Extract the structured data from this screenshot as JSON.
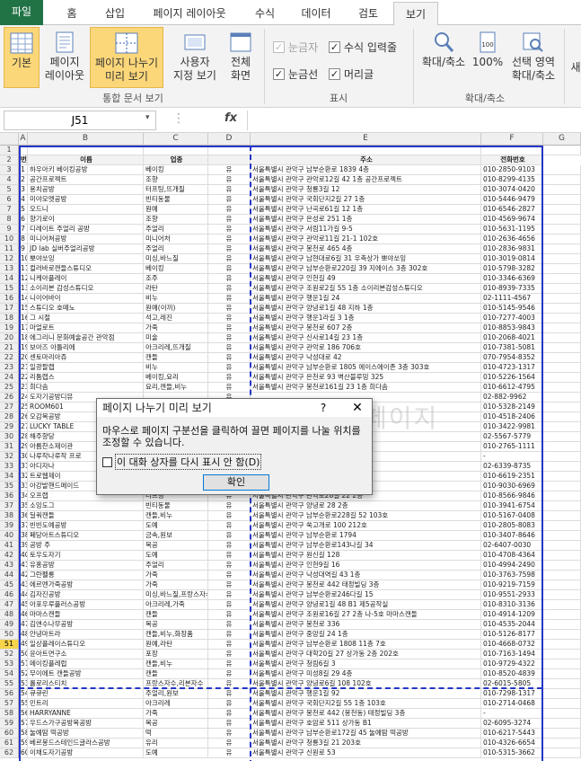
{
  "tabs": [
    "파일",
    "홈",
    "삽입",
    "페이지 레이아웃",
    "수식",
    "데이터",
    "검토",
    "보기"
  ],
  "ribbon": {
    "group1": {
      "buttons": [
        "기본",
        "페이지\n레이아웃",
        "페이지 나누기\n미리 보기",
        "사용자\n지정 보기",
        "전체\n화면"
      ],
      "label": "통합 문서 보기"
    },
    "group2": {
      "checks": [
        {
          "label": "눈금자",
          "checked": true,
          "disabled": true
        },
        {
          "label": "수식 입력줄",
          "checked": true,
          "disabled": false
        },
        {
          "label": "눈금선",
          "checked": true,
          "disabled": false
        },
        {
          "label": "머리글",
          "checked": true,
          "disabled": false
        }
      ],
      "label": "표시"
    },
    "group3": {
      "buttons": [
        "확대/축소",
        "100%",
        "선택 영역\n확대/축소"
      ],
      "label": "확대/축소"
    },
    "more_label": "새"
  },
  "formula_bar": {
    "namebox": "J51",
    "fx": "fx",
    "value": ""
  },
  "columns": [
    "A",
    "B",
    "C",
    "D",
    "E",
    "F",
    "G"
  ],
  "header_row": [
    "번호",
    "이름",
    "업종",
    "",
    "주소",
    "전화번호"
  ],
  "rows": [
    [
      "1",
      "하우아키 베이킹공방",
      "베이킹",
      "유",
      "서울특별시 관악구 남부순환로 1839 4층",
      "010-2850-9103"
    ],
    [
      "2",
      "공간프로젝트",
      "조향",
      "유",
      "서울특별시 관악구 관악로12길 42 1층 공간프로젝트",
      "010-8299-4135"
    ],
    [
      "3",
      "용치공방",
      "터프팅,뜨개질",
      "유",
      "서울특별시 관악구 청룡3길 12",
      "010-3074-0420"
    ],
    [
      "4",
      "미야모멧공방",
      "빈티동물",
      "유",
      "서울특별시 관악구 국회단지2길 27 1층",
      "010-5446-9479"
    ],
    [
      "5",
      "오드니",
      "원예",
      "유",
      "서울특별시 관악구 난곡로61길 12 1층",
      "010-6546-2827"
    ],
    [
      "6",
      "향기로이",
      "조향",
      "유",
      "서울특별시 관악구 은성로 251 1층",
      "010-4569-9674"
    ],
    [
      "7",
      "디레이트 주얼리 공방",
      "주얼리",
      "유",
      "서울특별시 관악구 서림11가길 9-5",
      "010-5631-1195"
    ],
    [
      "8",
      "미니어쳐공방",
      "미니어처",
      "유",
      "서울특별시 관악구 관악로11길 21-1 102호",
      "010-2636-4656"
    ],
    [
      "9",
      "JD lab 실버주얼리공방",
      "주얼리",
      "유",
      "서울특별시 관악구 봉천로 465 4층",
      "010-2836-9831"
    ],
    [
      "10",
      "뽀야쏘잉",
      "미싱,바느질",
      "유",
      "서울특별시 관악구 남현대로6길 31 우측상가 뽀야쏘잉",
      "010-3019-0814"
    ],
    [
      "11",
      "컬러바로캔들스튜디오",
      "베이킹",
      "유",
      "서울특별시 관악구 남부순환로220길 39 지에이스 3층 302호",
      "010-5798-3282"
    ],
    [
      "12",
      "니케아플레이",
      "조주",
      "유",
      "서울특별시 관악구 인헌길 49",
      "010-3346-6369"
    ],
    [
      "13",
      "소이리본 감성스튜디오",
      "라탄",
      "유",
      "서울특별시 관악구 조원로2길 55 1층 소이리본감성스튜디오",
      "010-8939-7335"
    ],
    [
      "14",
      "니이어바이",
      "비누",
      "유",
      "서울특별시 관악구 행운1길 24",
      "02-1111-4567"
    ],
    [
      "15",
      "스튜디오 호떼노",
      "원예(이끼)",
      "유",
      "서울특별시 관악구 양녕로1길 48 지하 1층",
      "010-5145-9546"
    ],
    [
      "16",
      "그 시절",
      "석고,레진",
      "유",
      "서울특별시 관악구 행운1라길 3 1층",
      "010-7277-4003"
    ],
    [
      "17",
      "마얼로트",
      "가죽",
      "유",
      "서울특별시 관악구 봉천로 607 2층",
      "010-8853-9843"
    ],
    [
      "18",
      "에그리니 문화예술공간 관악점",
      "미술",
      "유",
      "서울특별시 관악구 신사로14길 23 1층",
      "010-2068-4021"
    ],
    [
      "19",
      "보아즈 아틀리에",
      "아크리레,뜨개질",
      "유",
      "서울특별시 관악구 관악로 186 706호",
      "010-7381-5081"
    ],
    [
      "20",
      "센토마리아쥬",
      "캔들",
      "유",
      "서울특별시 관악구 낙성대로 42",
      "070-7954-8352"
    ],
    [
      "21",
      "일광팔랩",
      "비누",
      "유",
      "서울특별시 관악구 남부순환로 1805 에이스에이존 3층 303호",
      "010-4723-1317"
    ],
    [
      "22",
      "리툼랩스",
      "베이킹,요리",
      "유",
      "서울특별시 관악구 은천로 93 벽산블루밍 325",
      "010-5226-1564"
    ],
    [
      "23",
      "희다솜",
      "요리,캔들,비누",
      "유",
      "서울특별시 관악구 봉천로161길 23 1층 희다솜",
      "010-6612-4795"
    ],
    [
      "24",
      "도자기공방디뮤",
      "",
      "유",
      "",
      "02-882-9962"
    ],
    [
      "25",
      "ROOM601",
      "",
      "유",
      "",
      "010-5328-2149"
    ],
    [
      "26",
      "오감목공방",
      "",
      "유",
      "아파트 상가동 B1층",
      "010-4518-2406"
    ],
    [
      "27",
      "LUCKY TABLE",
      "",
      "유",
      "",
      "010-3422-9981"
    ],
    [
      "28",
      "해주향당",
      "",
      "유",
      "1층",
      "02-5567-5779"
    ],
    [
      "29",
      "아름찬소제이관",
      "",
      "유",
      "",
      "010-2765-1111"
    ],
    [
      "30",
      "나루작나루작 프로",
      "",
      "유",
      "",
      "-"
    ],
    [
      "31",
      "아디자나",
      "",
      "유",
      "SANAT",
      "02-6339-8735"
    ],
    [
      "32",
      "트로웹제이",
      "",
      "유",
      "제이",
      "010-6619-2351"
    ],
    [
      "33",
      "아강발핸드메이드",
      "",
      "유",
      "",
      "010-9030-6969"
    ],
    [
      "34",
      "오프랩",
      "터프팅",
      "유",
      "서울특별시 관악구 관악로28길 22 2층",
      "010-8566-9846"
    ],
    [
      "35",
      "소잉도그",
      "빈티동물",
      "유",
      "서울특별시 관악구 양녕로 28 2층",
      "010-3941-6754"
    ],
    [
      "36",
      "딜쿼캔들",
      "캔들,비누",
      "유",
      "서울특별시 관악구 남부순환로228길 52 103호",
      "010-5167-0408"
    ],
    [
      "37",
      "빈빈도예공방",
      "도예",
      "유",
      "서울특별시 관악구 쑥고개로 100 212호",
      "010-2805-8083"
    ],
    [
      "38",
      "폐당아트스튜디오",
      "금속,원보",
      "유",
      "서울특별시 관악구 남부순환로 1794",
      "010-3407-8646"
    ],
    [
      "39",
      "공방 주",
      "목공",
      "유",
      "서울특별시 관악구 남부순환로143나길 34",
      "02-6407-0030"
    ],
    [
      "40",
      "토우도자기",
      "도예",
      "유",
      "서울특별시 관악구 원신길 128",
      "010-4708-4364"
    ],
    [
      "41",
      "유홍공방",
      "주얼리",
      "유",
      "서울특별시 관악구 인헌9길 16",
      "010-4994-2490"
    ],
    [
      "42",
      "그란펠롱",
      "가죽",
      "유",
      "서울특별시 관악구 낙성대역길 43 1층",
      "010-3763-7598"
    ],
    [
      "43",
      "에르멘가죽공방",
      "가죽",
      "유",
      "서울특별시 관악구 봉천로 442 태정빌딩 3층",
      "010-9219-7159"
    ],
    [
      "44",
      "김자진공방",
      "미싱,바느질,프랑스자수",
      "유",
      "서울특별시 관악구 남부순환로246다길 15",
      "010-9551-2933"
    ],
    [
      "45",
      "아포우루플러스공방",
      "아크리레,가죽",
      "유",
      "서울특별시 관악구 양녕로1길 48 B1 제5공작실",
      "010-8310-3136"
    ],
    [
      "46",
      "마마스캔들",
      "캔들",
      "유",
      "서울특별시 관악구 조원로16길 27 2층 나-5호 마마스캔들",
      "010-4914-1209"
    ],
    [
      "47",
      "김앤수나무공방",
      "목공",
      "유",
      "서울특별시 관악구 봉천로 336",
      "010-4535-2044"
    ],
    [
      "48",
      "안녕마트라",
      "캔들,비누,화장품",
      "유",
      "서울특별시 관악구 중앙길 24 1층",
      "010-5126-8177"
    ],
    [
      "49",
      "일상플레이스튜디오",
      "원예,라탄",
      "유",
      "서울특별시 관악구 남부순환로 1808 11층 7호",
      "010-4668-0732"
    ],
    [
      "50",
      "윤아트면구소",
      "포장",
      "유",
      "서울특별시 관악구 대학20길 27 상가동 2층 202호",
      "010-7163-1494"
    ],
    [
      "51",
      "메이킹플레럽",
      "캔들,비누",
      "유",
      "서울특별시 관악구 청림6길 3",
      "010-9729-4322"
    ],
    [
      "52",
      "무이에트 캔들공방",
      "캔들",
      "유",
      "서울특별시 관악구 미성8길 29 4층",
      "010-8520-4839"
    ],
    [
      "53",
      "롤로리스티치",
      "프랑스자수,리본자수",
      "유",
      "서울특별시 관악구 양녕로6길 108 102호",
      "02-6015-5805"
    ],
    [
      "54",
      "큐큐린",
      "주얼리,원보",
      "유",
      "서울특별시 관악구 행운1길 92",
      "010-7298-1317"
    ],
    [
      "55",
      "민트리",
      "아크리레",
      "유",
      "서울특별시 관악구 국회단지2길 55 1층 103호",
      "010-2714-0468"
    ],
    [
      "56",
      "HARRYANNE",
      "가죽",
      "유",
      "서울특별시 관악구 봉천로 442 (봉천동) 태정빌딩 3층",
      "-"
    ],
    [
      "57",
      "우드스가구공방목공방",
      "목공",
      "유",
      "서울특별시 관악구 호암로 511 상가동 B1",
      "02-6095-3274"
    ],
    [
      "58",
      "눌예땀 떡공방",
      "떡",
      "유",
      "서울특별시 관악구 남부순환로172길 45 눌예땀 떡공방",
      "010-6217-5443"
    ],
    [
      "59",
      "베르봉드스테인드글라스공방",
      "유리",
      "유",
      "서울특별시 관악구 청룡3길 21 203호",
      "010-4326-6654"
    ],
    [
      "60",
      "이채도자기공방",
      "도예",
      "유",
      "서울특별시 관악구 신원로 53",
      "010-5315-3662"
    ]
  ],
  "selected_row": "51",
  "watermark": "페이지",
  "dialog": {
    "title": "페이지 나누기 미리 보기",
    "help": "?",
    "close": "✕",
    "message": "마우스로 페이지 구분선을 클릭하여 끌면 페이지를 나눌 위치를 조정할 수 있습니다.",
    "checkbox": "이 대화 상자를 다시 표시 안 함(D)",
    "ok": "확인"
  }
}
